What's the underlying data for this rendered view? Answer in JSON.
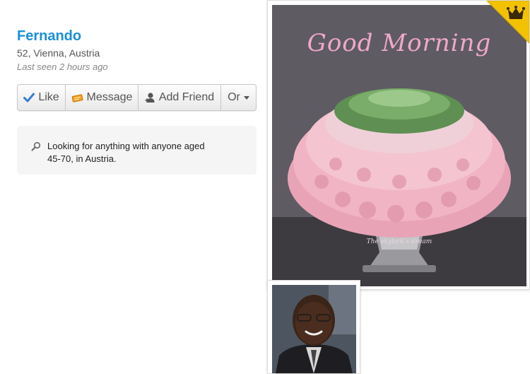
{
  "profile": {
    "name": "Fernando",
    "location": "52, Vienna, Austria",
    "last_seen": "Last seen 2 hours ago"
  },
  "actions": {
    "like_label": "Like",
    "message_label": "Message",
    "add_friend_label": "Add Friend",
    "more_label": "Or"
  },
  "looking_for": {
    "text": "Looking for anything with anyone aged 45-70, in Austria."
  },
  "photos": {
    "main_caption": "Good Morning",
    "main_watermark": "The skylark's dream"
  },
  "colors": {
    "name_blue": "#1a8fd8",
    "crown_gold": "#f2c200",
    "like_check_blue": "#3a7bd5",
    "message_ticket_orange": "#f0a020"
  },
  "icons": {
    "like": "check-icon",
    "message": "ticket-icon",
    "add_friend": "person-plus-icon",
    "more": "caret-down-icon",
    "looking": "search-icon",
    "badge": "crown-icon"
  }
}
